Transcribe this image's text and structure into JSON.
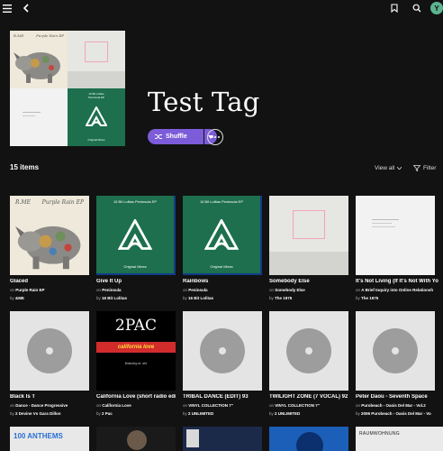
{
  "topbar": {
    "menu_icon": "menu-icon",
    "back_icon": "chevron-left-icon",
    "bookmark_icon": "bookmark-icon",
    "search_icon": "search-icon",
    "avatar_letter": "Y",
    "avatar_color": "#5bb38f"
  },
  "header": {
    "title": "Test Tag",
    "shuffle_label": "Shuffle",
    "accent_color": "#7c5cd9"
  },
  "list": {
    "count_label": "15 items",
    "view_label": "View all",
    "filter_label": "Filter"
  },
  "cover_tiles": [
    {
      "text1": "R.ME",
      "text2": "Purple Rain EP"
    },
    {
      "text1": "",
      "text2": ""
    },
    {
      "text1": "",
      "text2": ""
    },
    {
      "text1": "16 Bit Lolitas",
      "text2": "Peninsula EP",
      "footer": "Original Mixes"
    }
  ],
  "items": [
    {
      "title": "Glaced",
      "on_label": "on",
      "album": "Purple Rain EP",
      "by_label": "by",
      "artist": "&ME",
      "art": {
        "script1": "R.ME",
        "script2": "Purple Rain EP"
      }
    },
    {
      "title": "Give It Up",
      "on_label": "on",
      "album": "Peninsula",
      "by_label": "by",
      "artist": "16 Bit Lolitas",
      "art": {
        "header": "16 Bit Lolitas Peninsula EP",
        "footer": "Original Mixes"
      }
    },
    {
      "title": "Rainbows",
      "on_label": "on",
      "album": "Peninsula",
      "by_label": "by",
      "artist": "16 Bit Lolitas",
      "art": {
        "header": "16 Bit Lolitas Peninsula EP",
        "footer": "Original Mixes"
      }
    },
    {
      "title": "Somebody Else",
      "on_label": "on",
      "album": "Somebody Else",
      "by_label": "by",
      "artist": "The 1975"
    },
    {
      "title": "It's Not Living (If It's Not With Yo",
      "on_label": "on",
      "album": "A Brief Inquiry into Online Relationsh",
      "by_label": "by",
      "artist": "The 1975"
    },
    {
      "title": "Black Is T",
      "on_label": "on",
      "album": "Dance - Dance Progressive",
      "by_label": "by",
      "artist": "2 Devine Vs Gara Dillon"
    },
    {
      "title": "California Love (short radio edit)",
      "on_label": "on",
      "album": "California Love",
      "by_label": "by",
      "artist": "2 Pac",
      "art": {
        "num": "2PAC",
        "band": "california love",
        "sub": "featuring dr. dre"
      }
    },
    {
      "title": "TRIBAL DANCE (EDIT) 93",
      "on_label": "on",
      "album": "VINYL COLLECTION 7\"",
      "by_label": "by",
      "artist": "2 UNLIMITED"
    },
    {
      "title": "TWILIGHT ZONE (7 VOCAL) 92",
      "on_label": "on",
      "album": "VINYL COLLECTION 7\"",
      "by_label": "by",
      "artist": "2 UNLIMITED"
    },
    {
      "title": "Peter Daou - Seventh Space",
      "on_label": "on",
      "album": "Purobeach - Oasis Del Mar - Vol.2",
      "by_label": "by",
      "artist": "2006 Purobeach - Oasis Del Mar - Vo"
    }
  ],
  "row3_labels": [
    "100 ANTHEMS",
    "",
    "",
    "",
    "RAUMWOHNUNG"
  ]
}
